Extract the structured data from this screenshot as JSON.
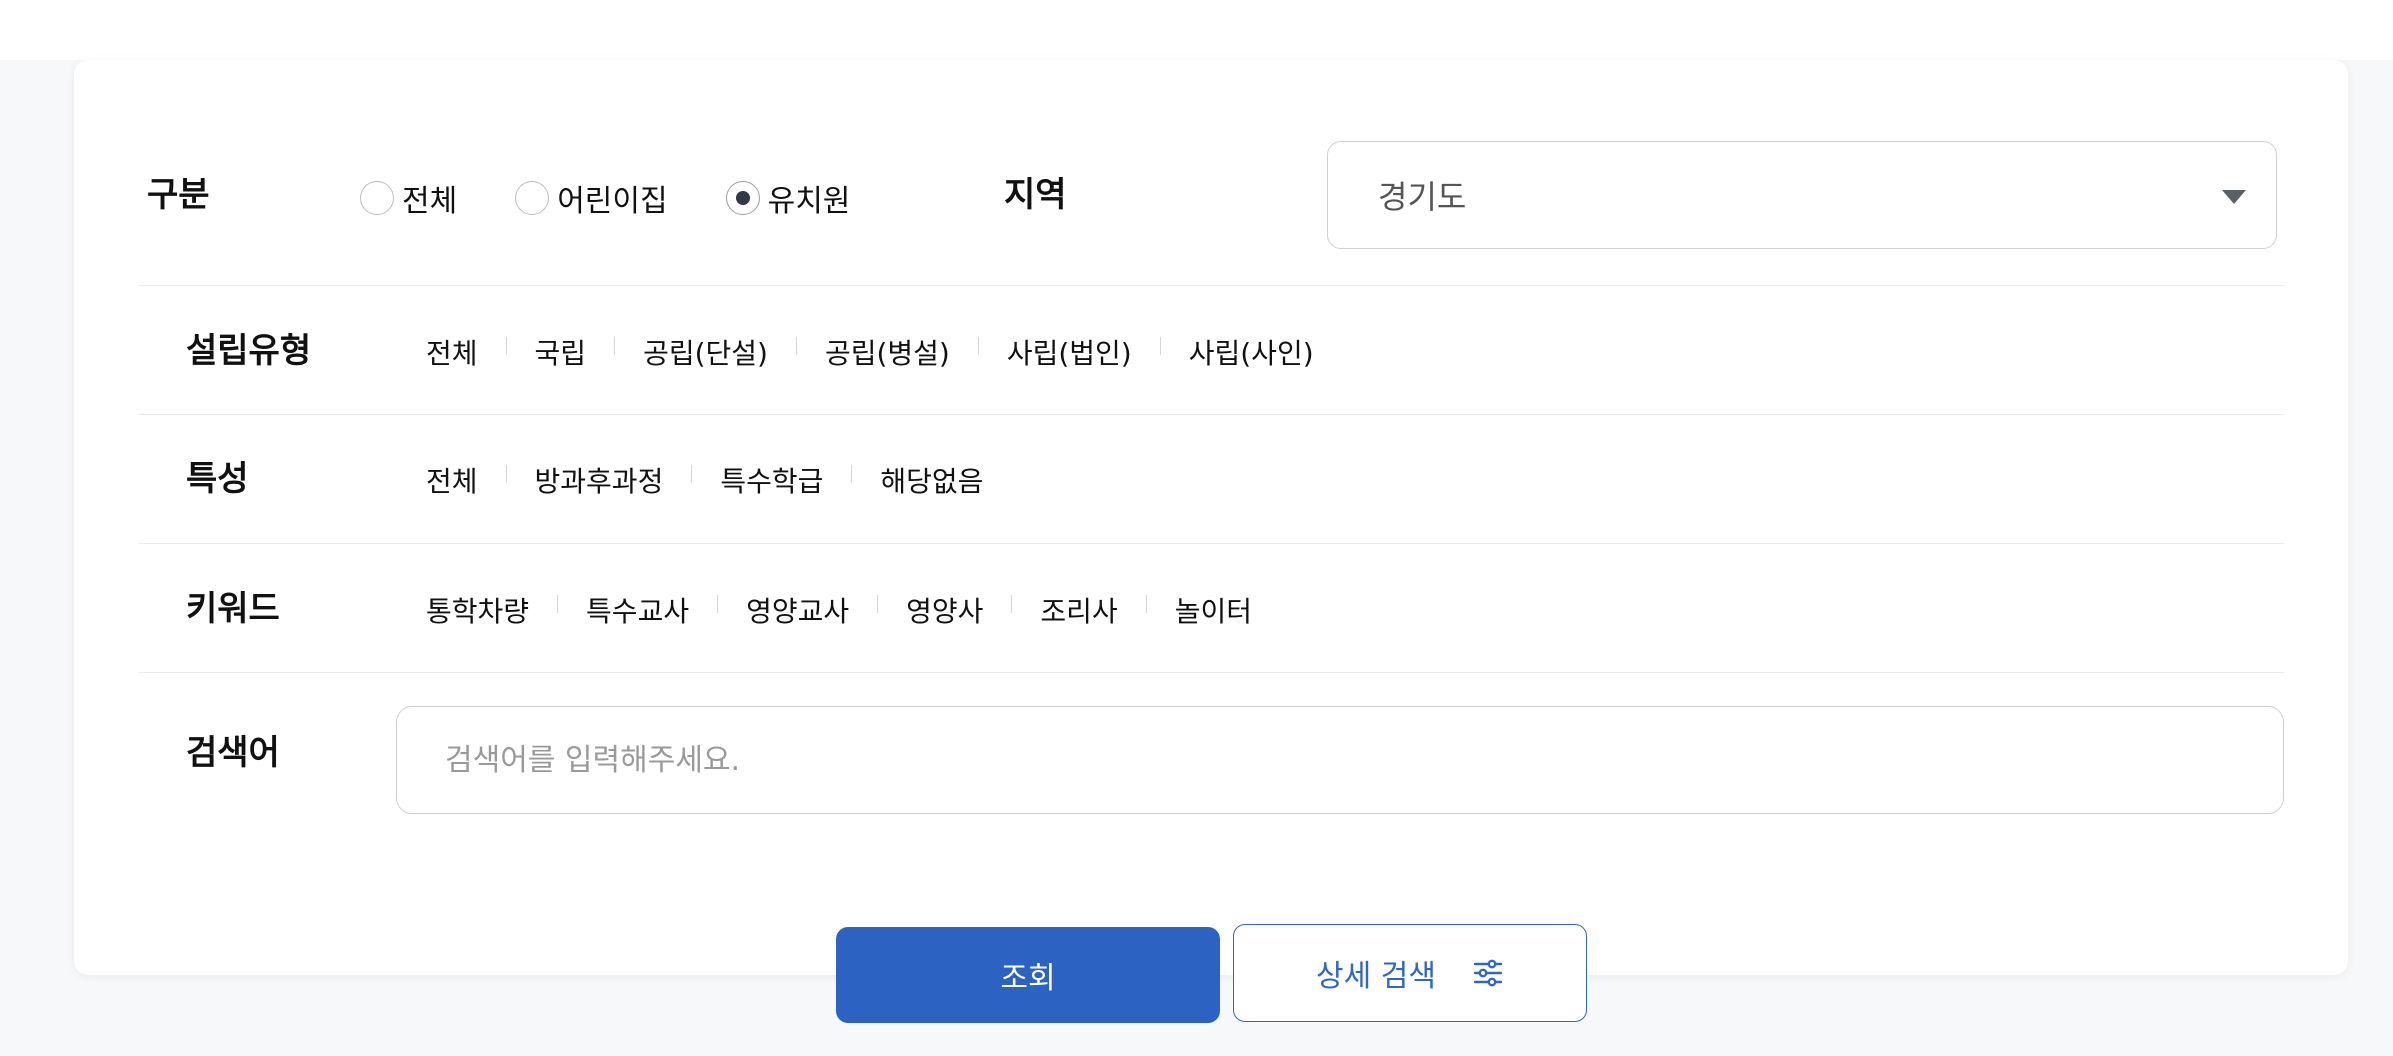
{
  "filters": {
    "category": {
      "label": "구분",
      "options": [
        "전체",
        "어린이집",
        "유치원"
      ],
      "selected": "유치원"
    },
    "region": {
      "label": "지역",
      "value": "경기도"
    },
    "establishment": {
      "label": "설립유형",
      "options": [
        "전체",
        "국립",
        "공립(단설)",
        "공립(병설)",
        "사립(법인)",
        "사립(사인)"
      ]
    },
    "features": {
      "label": "특성",
      "options": [
        "전체",
        "방과후과정",
        "특수학급",
        "해당없음"
      ]
    },
    "keywords": {
      "label": "키워드",
      "options": [
        "통학차량",
        "특수교사",
        "영양교사",
        "영양사",
        "조리사",
        "놀이터"
      ]
    },
    "search": {
      "label": "검색어",
      "placeholder": "검색어를 입력해주세요.",
      "value": ""
    }
  },
  "actions": {
    "submit_label": "조회",
    "advanced_label": "상세 검색"
  },
  "colors": {
    "primary": "#2c63c3",
    "outline": "#2f66c8",
    "radio_checked": "#333a45"
  }
}
